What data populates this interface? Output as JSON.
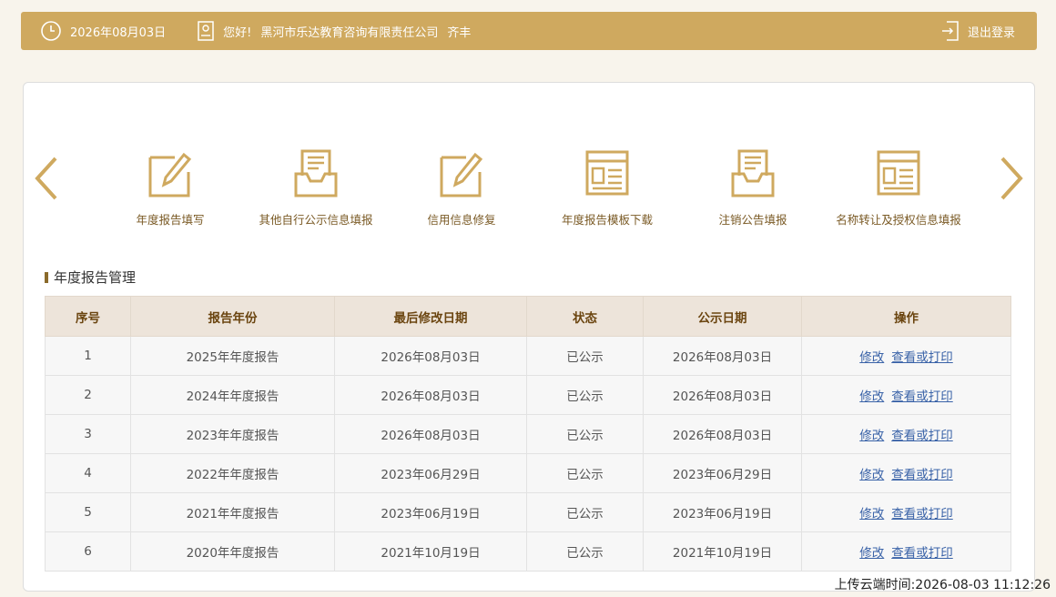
{
  "header": {
    "date": "2026年08月03日",
    "greeting": "您好!",
    "company": "黑河市乐达教育咨询有限责任公司",
    "user": "齐丰",
    "logout_label": "退出登录"
  },
  "nav": {
    "items": [
      {
        "label": "年度报告填写",
        "icon": "edit-icon"
      },
      {
        "label": "其他自行公示信息填报",
        "icon": "inbox-icon"
      },
      {
        "label": "信用信息修复",
        "icon": "edit-icon"
      },
      {
        "label": "年度报告模板下载",
        "icon": "template-icon"
      },
      {
        "label": "注销公告填报",
        "icon": "inbox-icon"
      },
      {
        "label": "名称转让及授权信息填报",
        "icon": "template-icon"
      }
    ]
  },
  "section": {
    "title": "年度报告管理"
  },
  "table": {
    "headers": [
      "序号",
      "报告年份",
      "最后修改日期",
      "状态",
      "公示日期",
      "操作"
    ],
    "rows": [
      {
        "no": "1",
        "year": "2025年年度报告",
        "modified": "2026年08月03日",
        "status": "已公示",
        "published": "2026年08月03日",
        "edit": "修改",
        "view": "查看或打印"
      },
      {
        "no": "2",
        "year": "2024年年度报告",
        "modified": "2026年08月03日",
        "status": "已公示",
        "published": "2026年08月03日",
        "edit": "修改",
        "view": "查看或打印"
      },
      {
        "no": "3",
        "year": "2023年年度报告",
        "modified": "2026年08月03日",
        "status": "已公示",
        "published": "2026年08月03日",
        "edit": "修改",
        "view": "查看或打印"
      },
      {
        "no": "4",
        "year": "2022年年度报告",
        "modified": "2023年06月29日",
        "status": "已公示",
        "published": "2023年06月29日",
        "edit": "修改",
        "view": "查看或打印"
      },
      {
        "no": "5",
        "year": "2021年年度报告",
        "modified": "2023年06月19日",
        "status": "已公示",
        "published": "2023年06月19日",
        "edit": "修改",
        "view": "查看或打印"
      },
      {
        "no": "6",
        "year": "2020年年度报告",
        "modified": "2021年10月19日",
        "status": "已公示",
        "published": "2021年10月19日",
        "edit": "修改",
        "view": "查看或打印"
      }
    ]
  },
  "footer": {
    "timestamp": "上传云端时间:2026-08-03 11:12:26"
  },
  "colors": {
    "accent": "#cfa95f",
    "header_bg": "#ede4da",
    "link": "#3a63a8"
  }
}
